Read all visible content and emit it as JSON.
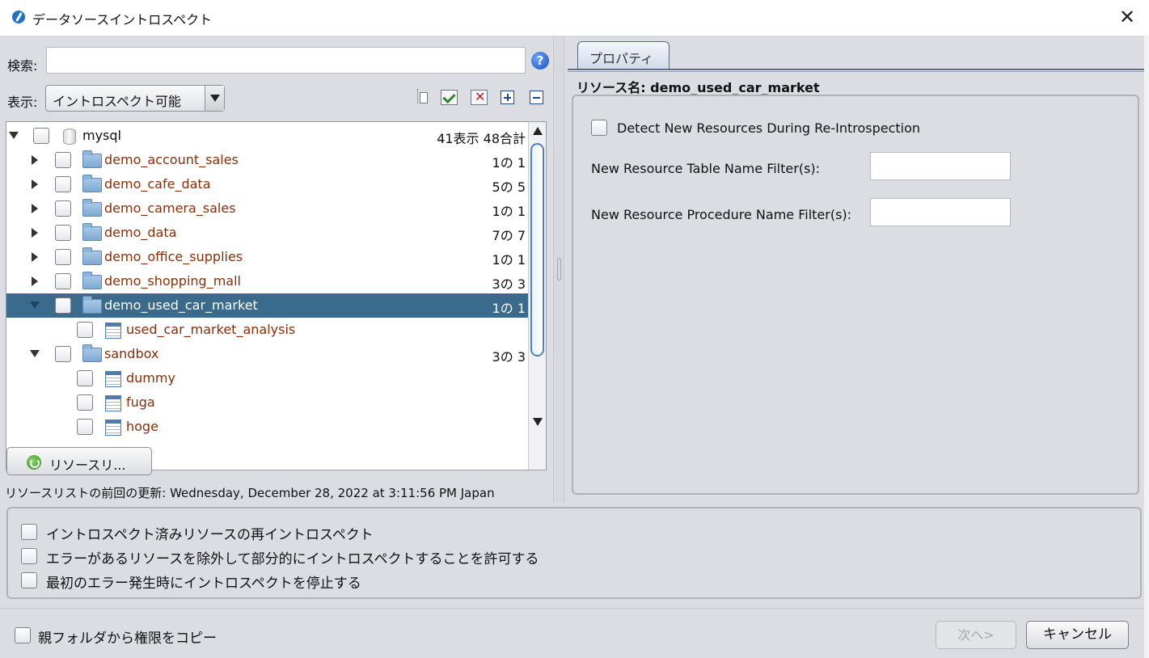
{
  "window": {
    "title": "データソースイントロスペクト",
    "close": "✕"
  },
  "search": {
    "label": "検索:",
    "value": "",
    "placeholder": "",
    "help": "?"
  },
  "view": {
    "label": "表示:",
    "selected": "イントロスペクト可能"
  },
  "tree": {
    "root": {
      "label": "mysql",
      "count": "41表示 48合計"
    },
    "items": [
      {
        "label": "demo_account_sales",
        "count": "1の 1",
        "type": "folder",
        "state": "closed"
      },
      {
        "label": "demo_cafe_data",
        "count": "5の 5",
        "type": "folder",
        "state": "closed"
      },
      {
        "label": "demo_camera_sales",
        "count": "1の 1",
        "type": "folder",
        "state": "closed"
      },
      {
        "label": "demo_data",
        "count": "7の 7",
        "type": "folder",
        "state": "closed"
      },
      {
        "label": "demo_office_supplies",
        "count": "1の 1",
        "type": "folder",
        "state": "closed"
      },
      {
        "label": "demo_shopping_mall",
        "count": "3の 3",
        "type": "folder",
        "state": "closed"
      },
      {
        "label": "demo_used_car_market",
        "count": "1の 1",
        "type": "folder",
        "state": "open",
        "selected": true
      },
      {
        "label": "used_car_market_analysis",
        "count": "",
        "type": "table"
      },
      {
        "label": "sandbox",
        "count": "3の 3",
        "type": "folder",
        "state": "open"
      },
      {
        "label": "dummy",
        "count": "",
        "type": "table"
      },
      {
        "label": "fuga",
        "count": "",
        "type": "table"
      },
      {
        "label": "hoge",
        "count": "",
        "type": "table"
      }
    ]
  },
  "refresh": {
    "label": "リソースリ...",
    "last_update": "リソースリストの前回の更新: Wednesday, December 28, 2022 at 3:11:56 PM Japan"
  },
  "properties": {
    "tab": "プロパティ",
    "resource_name": "リソース名: demo_used_car_market",
    "detect_label": "Detect New Resources During Re-Introspection",
    "table_filter_label": "New Resource Table Name Filter(s):",
    "table_filter_value": "",
    "procedure_filter_label": "New Resource Procedure Name Filter(s):",
    "procedure_filter_value": ""
  },
  "options": {
    "reintrospect": "イントロスペクト済みリソースの再イントロスペクト",
    "allow_partial": "エラーがあるリソースを除外して部分的にイントロスペクトすることを許可する",
    "stop_on_error": "最初のエラー発生時にイントロスペクトを停止する"
  },
  "footer": {
    "copy_permissions": "親フォルダから権限をコピー",
    "next": "次へ>",
    "cancel": "キャンセル"
  }
}
